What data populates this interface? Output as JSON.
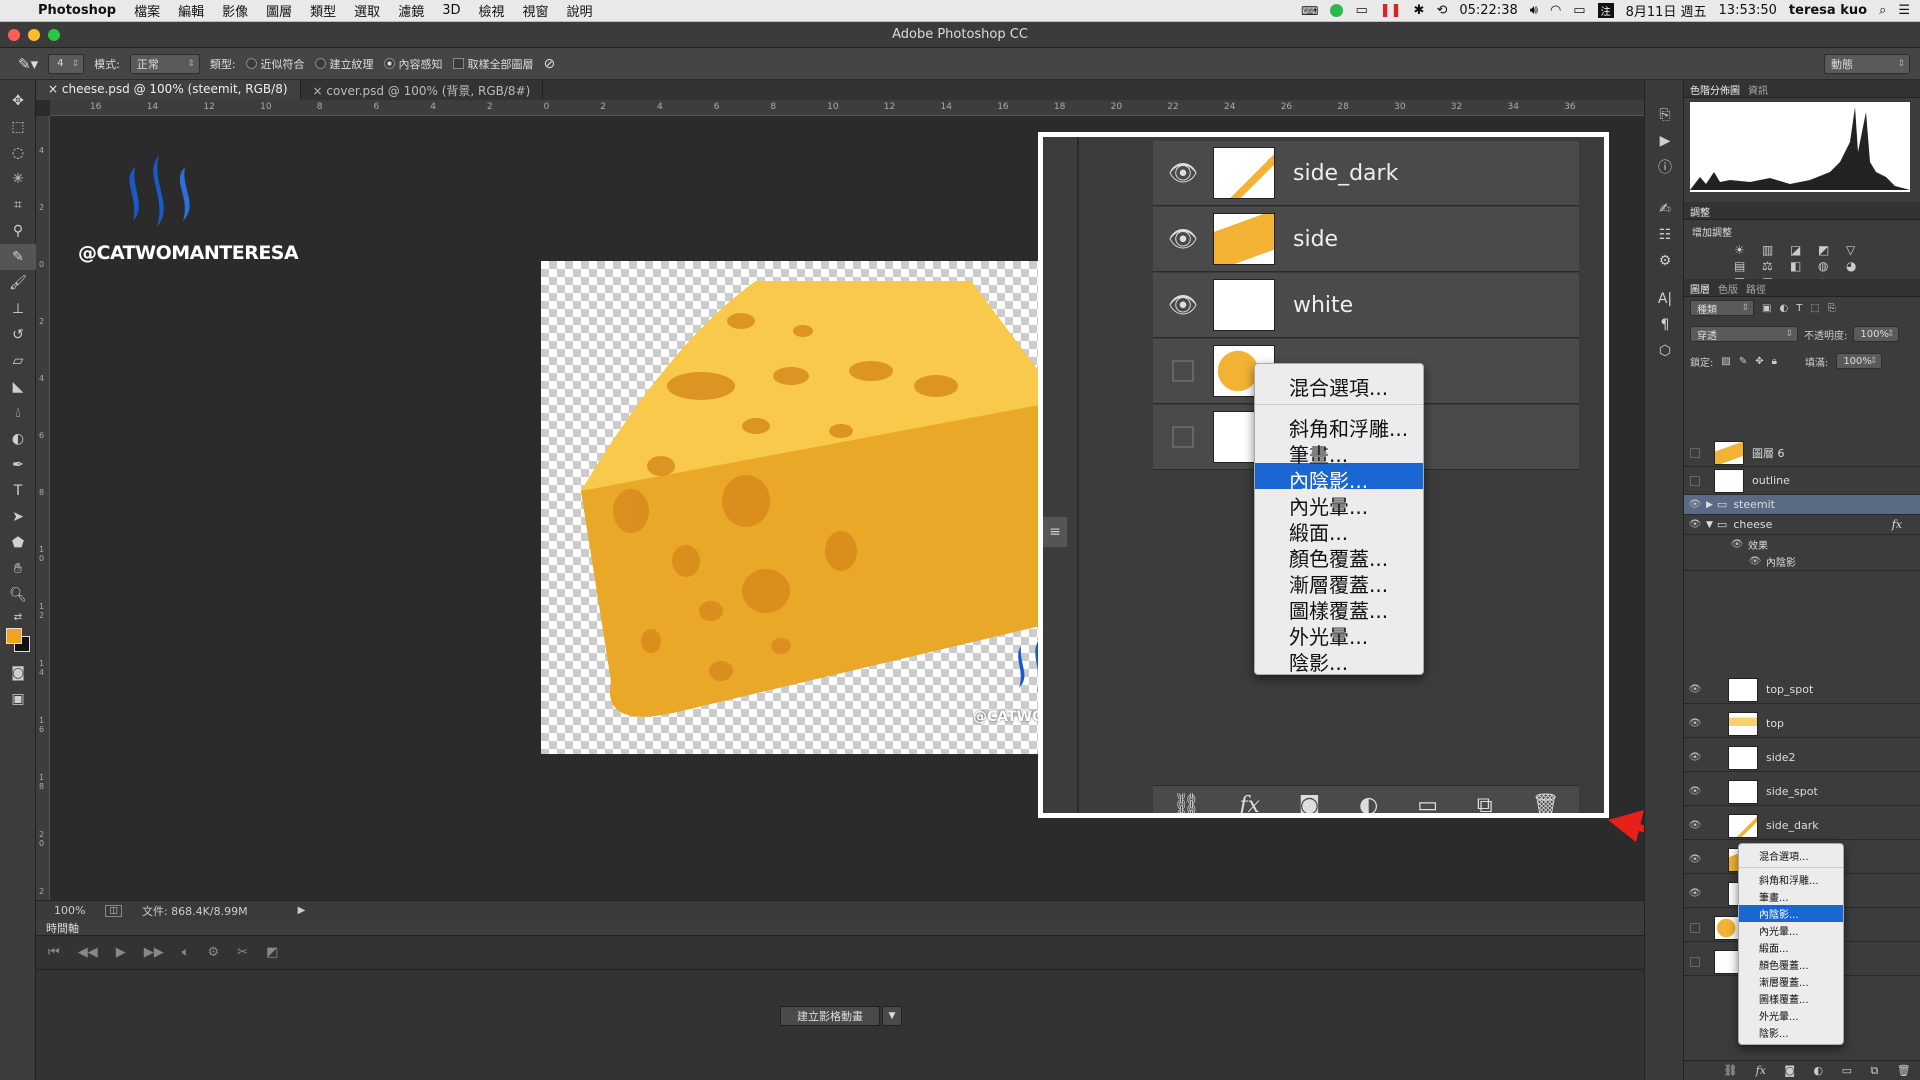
{
  "menubar": {
    "apple": "",
    "app_name": "Photoshop",
    "items": [
      "檔案",
      "編輯",
      "影像",
      "圖層",
      "類型",
      "選取",
      "濾鏡",
      "3D",
      "檢視",
      "視窗",
      "說明"
    ],
    "time_left": "05:22:38",
    "date": "8月11日 週五",
    "clock": "13:53:50",
    "user": "teresa kuo"
  },
  "window": {
    "title": "Adobe Photoshop CC"
  },
  "options": {
    "brush_size": "4",
    "mode_label": "模式:",
    "mode_value": "正常",
    "type_label": "類型:",
    "type_options": [
      {
        "label": "近似符合",
        "selected": false
      },
      {
        "label": "建立紋理",
        "selected": false
      },
      {
        "label": "內容感知",
        "selected": true
      }
    ],
    "sample_all": "取樣全部圖層",
    "workspace": "動態"
  },
  "tabs": [
    {
      "label": "cheese.psd @ 100% (steemit, RGB/8)",
      "active": true
    },
    {
      "label": "cover.psd @ 100% (背景, RGB/8#)",
      "active": false
    }
  ],
  "ruler_h": [
    "16",
    "14",
    "12",
    "10",
    "8",
    "6",
    "4",
    "2",
    "0",
    "2",
    "4",
    "6",
    "8",
    "10",
    "12",
    "14",
    "16",
    "18",
    "20",
    "22",
    "24",
    "26",
    "28",
    "30",
    "32",
    "34",
    "36"
  ],
  "ruler_v": [
    "4",
    "2",
    "0",
    "2",
    "4",
    "6",
    "8",
    "1\n0",
    "1\n2",
    "1\n4",
    "1\n6",
    "1\n8",
    "2\n0",
    "2"
  ],
  "watermark": {
    "handle": "@CATWOMANTERESA",
    "partial": "@CATWO"
  },
  "status": {
    "zoom": "100%",
    "doc": "文件: 868.4K/8.99M"
  },
  "timeline": {
    "title": "時間軸",
    "create_button": "建立影格動畫"
  },
  "panels": {
    "histogram_tabs": [
      "色階分佈圖",
      "資訊"
    ],
    "adjust_tab": "調整",
    "adjust_title": "增加調整",
    "layer_tabs": [
      "圖層",
      "色版",
      "路徑"
    ],
    "kind_filter": "種類",
    "blend_mode": "穿透",
    "opacity_label": "不透明度:",
    "opacity": "100%",
    "lock_label": "鎖定:",
    "fill_label": "填滿:",
    "fill": "100%",
    "fx_mark": "fx"
  },
  "layers": [
    {
      "name": "圖層 6",
      "visible": false,
      "selected": false
    },
    {
      "name": "outline",
      "visible": false,
      "selected": false
    },
    {
      "name": "steemit",
      "visible": true,
      "selected": true,
      "folder": true
    },
    {
      "name": "cheese",
      "visible": true,
      "selected": false,
      "folder": true,
      "fx": true
    },
    {
      "name": "效果",
      "visible": true,
      "sub": 1
    },
    {
      "name": "內陰影",
      "visible": true,
      "sub": 2
    },
    {
      "name": "top_spot",
      "visible": true,
      "selected": false
    },
    {
      "name": "top",
      "visible": true,
      "selected": false
    },
    {
      "name": "side2",
      "visible": true,
      "selected": false
    },
    {
      "name": "side_spot",
      "visible": true,
      "selected": false
    },
    {
      "name": "side_dark",
      "visible": true,
      "selected": false
    },
    {
      "name": "side",
      "visible": true,
      "selected": false
    },
    {
      "name": "white",
      "visible": true,
      "selected": false
    }
  ],
  "zoom_layers": [
    "side_dark",
    "side",
    "white"
  ],
  "context_menu": {
    "items": [
      "混合選項...",
      "斜角和浮雕...",
      "筆畫...",
      "內陰影...",
      "內光暈...",
      "緞面...",
      "顏色覆蓋...",
      "漸層覆蓋...",
      "圖樣覆蓋...",
      "外光暈...",
      "陰影..."
    ],
    "highlighted_index": 3
  },
  "colors": {
    "accent": "#1a66d2",
    "cheese": "#f2b233",
    "arrow": "#e8201a",
    "steem_blue": "#1a5ac8"
  }
}
